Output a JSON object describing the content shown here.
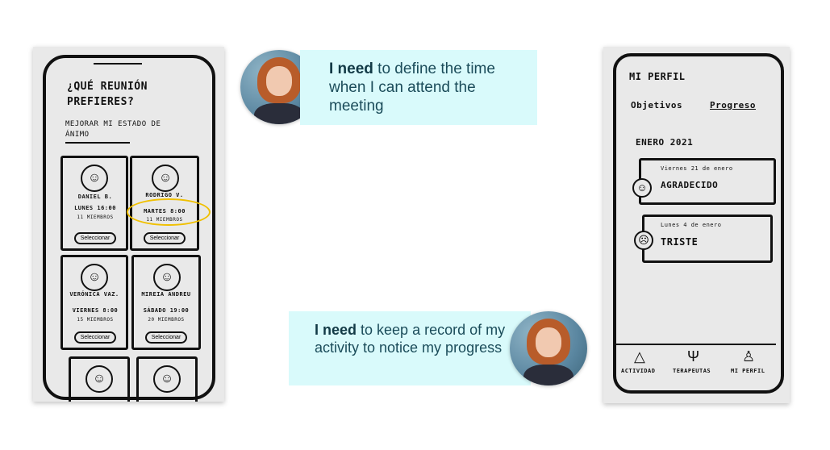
{
  "left_sketch": {
    "title": "¿Qué reunión prefieres?",
    "subtitle": "Mejorar mi estado de ánimo",
    "cards": [
      {
        "name": "Daniel B.",
        "schedule": "Lunes 16:00",
        "members": "11 miembros",
        "button": "Seleccionar"
      },
      {
        "name": "Rodrigo V.",
        "schedule": "Martes 8:00",
        "members": "11 miembros",
        "button": "Seleccionar"
      },
      {
        "name": "Verónica Vaz.",
        "schedule": "Viernes 8:00",
        "members": "15 miembros",
        "button": "Seleccionar"
      },
      {
        "name": "Mireia Andreu",
        "schedule": "Sábado 19:00",
        "members": "20 miembros",
        "button": "Seleccionar"
      }
    ]
  },
  "bubble_top": {
    "bold": "I need",
    "text": " to define the time when I can attend the meeting"
  },
  "bubble_bottom": {
    "bold": "I need",
    "text": " to keep a record of my activity to notice my progress"
  },
  "right_sketch": {
    "title": "Mi perfil",
    "tabs": [
      "Objetivos",
      "Progreso"
    ],
    "month": "Enero 2021",
    "entries": [
      {
        "date": "Viernes 21 de enero",
        "mood": "Agradecido",
        "icon": "happy-face-icon"
      },
      {
        "date": "Lunes 4 de enero",
        "mood": "Triste",
        "icon": "sad-face-icon"
      }
    ],
    "bottom_nav": [
      "Actividad",
      "Terapeutas",
      "Mi perfil"
    ]
  },
  "colors": {
    "bubble_bg": "#d9fafb",
    "bubble_text": "#1b4c5a",
    "highlight_ring": "#f0c000"
  }
}
